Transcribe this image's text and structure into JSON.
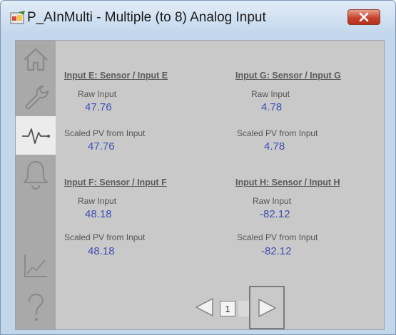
{
  "window": {
    "title": "P_AInMulti - Multiple (to 8) Analog Input",
    "close_icon": "close-x-icon"
  },
  "sidebar": {
    "items": [
      {
        "icon": "home-icon",
        "label": "Home",
        "active": false
      },
      {
        "icon": "wrench-icon",
        "label": "Maintenance",
        "active": false
      },
      {
        "icon": "waveform-icon",
        "label": "Trends",
        "active": true
      },
      {
        "icon": "bell-icon",
        "label": "Alarms",
        "active": false
      },
      {
        "icon": "trend-chart-icon",
        "label": "Quick Trend",
        "active": false
      },
      {
        "icon": "question-icon",
        "label": "Help",
        "active": false
      }
    ]
  },
  "inputs": {
    "e": {
      "title": "Input E: Sensor / Input E",
      "raw_label": "Raw Input",
      "raw_value": "47.76",
      "scaled_label": "Scaled PV from Input",
      "scaled_value": "47.76"
    },
    "g": {
      "title": "Input G: Sensor / Input G",
      "raw_label": "Raw Input",
      "raw_value": "4.78",
      "scaled_label": "Scaled PV from Input",
      "scaled_value": "4.78"
    },
    "f": {
      "title": "Input F: Sensor / Input F",
      "raw_label": "Raw Input",
      "raw_value": "48.18",
      "scaled_label": "Scaled PV from Input",
      "scaled_value": "48.18"
    },
    "h": {
      "title": "Input H: Sensor / Input H",
      "raw_label": "Raw Input",
      "raw_value": "-82.12",
      "scaled_label": "Scaled PV from Input",
      "scaled_value": "-82.12"
    }
  },
  "pager": {
    "current_page": "1"
  },
  "colors": {
    "value_blue": "#3f4fb5",
    "sidebar_gray": "#a9a9a9",
    "content_gray": "#c9c9c9",
    "title_bar": "#c3d7ec",
    "close_red": "#c7432c"
  }
}
